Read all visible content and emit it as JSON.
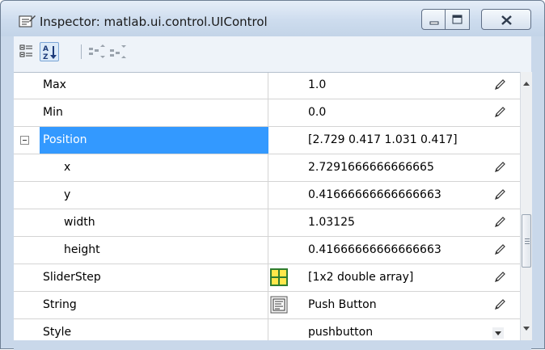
{
  "window": {
    "title": "Inspector:  matlab.ui.control.UIControl"
  },
  "toolbar": {
    "buttons": [
      {
        "icon": "categorized-view-icon"
      },
      {
        "icon": "sort-alphabetical-icon",
        "active": true
      },
      {
        "icon": "expand-all-icon"
      },
      {
        "icon": "collapse-all-icon"
      }
    ]
  },
  "properties": [
    {
      "name": "Max",
      "value": "1.0",
      "editor": null,
      "action": "pencil",
      "indent": 1
    },
    {
      "name": "Min",
      "value": "0.0",
      "editor": null,
      "action": "pencil",
      "indent": 1
    },
    {
      "name": "Position",
      "value": "[2.729 0.417 1.031 0.417]",
      "editor": null,
      "action": null,
      "indent": 1,
      "expanded": true,
      "selected": true
    },
    {
      "name": "x",
      "value": "2.7291666666666665",
      "editor": null,
      "action": "pencil",
      "indent": 2
    },
    {
      "name": "y",
      "value": "0.41666666666666663",
      "editor": null,
      "action": "pencil",
      "indent": 2
    },
    {
      "name": "width",
      "value": "1.03125",
      "editor": null,
      "action": "pencil",
      "indent": 2
    },
    {
      "name": "height",
      "value": "0.41666666666666663",
      "editor": null,
      "action": "pencil",
      "indent": 2
    },
    {
      "name": "SliderStep",
      "value": "[1x2  double array]",
      "editor": "array-editor-icon",
      "action": "pencil",
      "indent": 1
    },
    {
      "name": "String",
      "value": "Push Button",
      "editor": "text-editor-icon",
      "action": "pencil",
      "indent": 1
    },
    {
      "name": "Style",
      "value": "pushbutton",
      "editor": null,
      "action": "dropdown",
      "indent": 1
    }
  ],
  "colors": {
    "selection": "#3399ff",
    "frame": "#c9d8ea"
  }
}
